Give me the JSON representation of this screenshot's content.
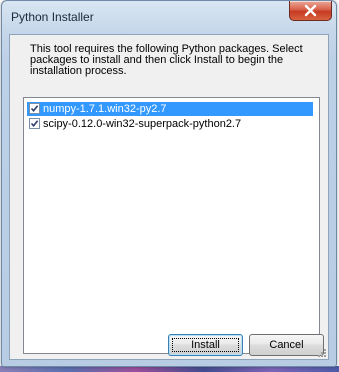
{
  "window": {
    "title": "Python Installer",
    "close_label": "x"
  },
  "message": "This tool requires the following Python packages. Select packages to install and then click Install to begin the installation process.",
  "packages": [
    {
      "label": "numpy-1.7.1.win32-py2.7",
      "checked": true,
      "selected": true
    },
    {
      "label": "scipy-0.12.0-win32-superpack-python2.7",
      "checked": true,
      "selected": false
    }
  ],
  "buttons": {
    "install_label": "Install",
    "cancel_label": "Cancel"
  },
  "colors": {
    "selection": "#3399ff",
    "close_button": "#c63a23",
    "dialog_background": "#f0f0f0"
  },
  "icons": {
    "close": "close-icon",
    "check": "check-icon",
    "grip": "resize-grip-icon"
  }
}
